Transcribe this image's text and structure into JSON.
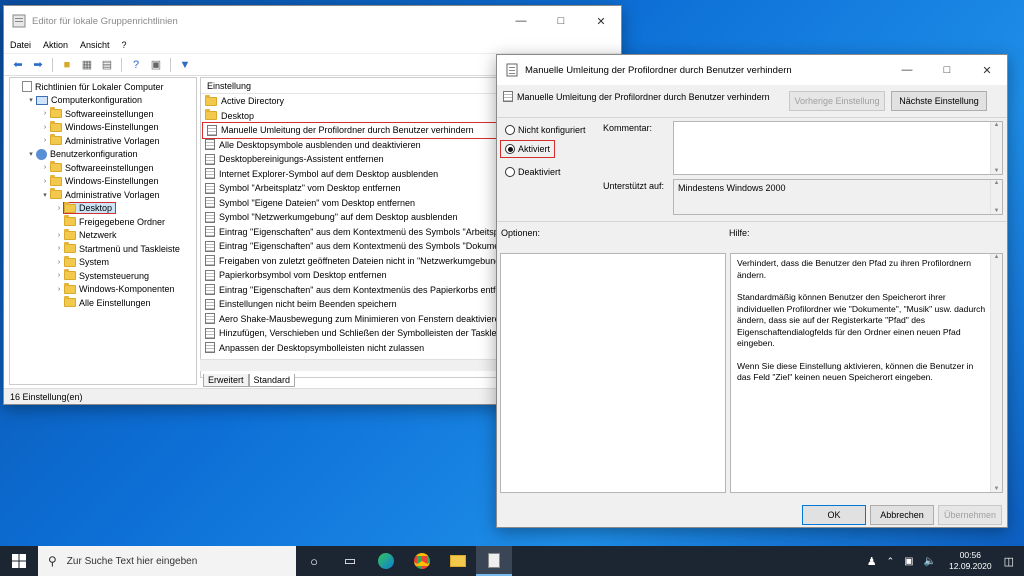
{
  "gpedit": {
    "title": "Editor für lokale Gruppenrichtlinien",
    "menu": [
      "Datei",
      "Aktion",
      "Ansicht",
      "?"
    ],
    "tree": [
      {
        "label": "Richtlinien für Lokaler Computer",
        "level": 0,
        "icon": "doc",
        "arrow": ""
      },
      {
        "label": "Computerkonfiguration",
        "level": 1,
        "icon": "pc",
        "arrow": "v"
      },
      {
        "label": "Softwareeinstellungen",
        "level": 2,
        "icon": "folder",
        "arrow": ">"
      },
      {
        "label": "Windows-Einstellungen",
        "level": 2,
        "icon": "folder",
        "arrow": ">"
      },
      {
        "label": "Administrative Vorlagen",
        "level": 2,
        "icon": "folder",
        "arrow": ">"
      },
      {
        "label": "Benutzerkonfiguration",
        "level": 1,
        "icon": "user",
        "arrow": "v"
      },
      {
        "label": "Softwareeinstellungen",
        "level": 2,
        "icon": "folder",
        "arrow": ">"
      },
      {
        "label": "Windows-Einstellungen",
        "level": 2,
        "icon": "folder",
        "arrow": ">"
      },
      {
        "label": "Administrative Vorlagen",
        "level": 2,
        "icon": "folder",
        "arrow": "v"
      },
      {
        "label": "Desktop",
        "level": 3,
        "icon": "folder",
        "arrow": ">",
        "selected": true
      },
      {
        "label": "Freigegebene Ordner",
        "level": 3,
        "icon": "folder",
        "arrow": ""
      },
      {
        "label": "Netzwerk",
        "level": 3,
        "icon": "folder",
        "arrow": ">"
      },
      {
        "label": "Startmenü und Taskleiste",
        "level": 3,
        "icon": "folder",
        "arrow": ">"
      },
      {
        "label": "System",
        "level": 3,
        "icon": "folder",
        "arrow": ">"
      },
      {
        "label": "Systemsteuerung",
        "level": 3,
        "icon": "folder",
        "arrow": ">"
      },
      {
        "label": "Windows-Komponenten",
        "level": 3,
        "icon": "folder",
        "arrow": ">"
      },
      {
        "label": "Alle Einstellungen",
        "level": 3,
        "icon": "folder",
        "arrow": ""
      }
    ],
    "list_header": "Einstellung",
    "list": [
      {
        "label": "Active Directory",
        "icon": "folder"
      },
      {
        "label": "Desktop",
        "icon": "folder"
      },
      {
        "label": "Manuelle Umleitung der Profilordner durch Benutzer verhindern",
        "icon": "setting",
        "highlight": true
      },
      {
        "label": "Alle Desktopsymbole ausblenden und deaktivieren",
        "icon": "setting"
      },
      {
        "label": "Desktopbereinigungs-Assistent entfernen",
        "icon": "setting"
      },
      {
        "label": "Internet Explorer-Symbol auf dem Desktop ausblenden",
        "icon": "setting"
      },
      {
        "label": "Symbol \"Arbeitsplatz\" vom Desktop entfernen",
        "icon": "setting"
      },
      {
        "label": "Symbol \"Eigene Dateien\" vom Desktop entfernen",
        "icon": "setting"
      },
      {
        "label": "Symbol \"Netzwerkumgebung\" auf dem Desktop ausblenden",
        "icon": "setting"
      },
      {
        "label": "Eintrag \"Eigenschaften\" aus dem Kontextmenü des Symbols \"Arbeitsplatz",
        "icon": "setting"
      },
      {
        "label": "Eintrag \"Eigenschaften\" aus dem Kontextmenü des Symbols \"Dokumente",
        "icon": "setting"
      },
      {
        "label": "Freigaben von zuletzt geöffneten Dateien nicht in \"Netzwerkumgebung",
        "icon": "setting"
      },
      {
        "label": "Papierkorbsymbol vom Desktop entfernen",
        "icon": "setting"
      },
      {
        "label": "Eintrag \"Eigenschaften\" aus dem Kontextmenüs des Papierkorbs entferne",
        "icon": "setting"
      },
      {
        "label": "Einstellungen nicht beim Beenden speichern",
        "icon": "setting"
      },
      {
        "label": "Aero Shake-Mausbewegung zum Minimieren von Fenstern deaktivieren",
        "icon": "setting"
      },
      {
        "label": "Hinzufügen, Verschieben und Schließen der Symbolleisten der Taskleiste",
        "icon": "setting"
      },
      {
        "label": "Anpassen der Desktopsymbolleisten nicht zulassen",
        "icon": "setting"
      }
    ],
    "tabs": [
      "Erweitert",
      "Standard"
    ],
    "status": "16 Einstellung(en)"
  },
  "dialog": {
    "title": "Manuelle Umleitung der Profilordner durch Benutzer verhindern",
    "heading": "Manuelle Umleitung der Profilordner durch Benutzer verhindern",
    "prev_button": "Vorherige Einstellung",
    "next_button": "Nächste Einstellung",
    "radio_not_configured": "Nicht konfiguriert",
    "radio_enabled": "Aktiviert",
    "radio_disabled": "Deaktiviert",
    "selected": "Aktiviert",
    "comment_label": "Kommentar:",
    "supported_label": "Unterstützt auf:",
    "supported_value": "Mindestens Windows 2000",
    "options_label": "Optionen:",
    "help_label": "Hilfe:",
    "help_paragraphs": [
      "Verhindert, dass die Benutzer den Pfad zu ihren Profilordnern ändern.",
      "Standardmäßig können Benutzer den Speicherort ihrer individuellen Profilordner wie \"Dokumente\", \"Musik\" usw. dadurch ändern, dass sie auf der Registerkarte \"Pfad\" des Eigenschaftendialogfelds für den Ordner einen neuen Pfad eingeben.",
      "Wenn Sie diese Einstellung aktivieren, können die Benutzer in das Feld \"Ziel\" keinen neuen Speicherort eingeben."
    ],
    "ok": "OK",
    "cancel": "Abbrechen",
    "apply": "Übernehmen"
  },
  "taskbar": {
    "search_placeholder": "Zur Suche Text hier eingeben",
    "time": "00:56",
    "date": "12.09.2020"
  },
  "colors": {
    "highlight_red": "#d32f2f",
    "accent": "#0078d7"
  }
}
